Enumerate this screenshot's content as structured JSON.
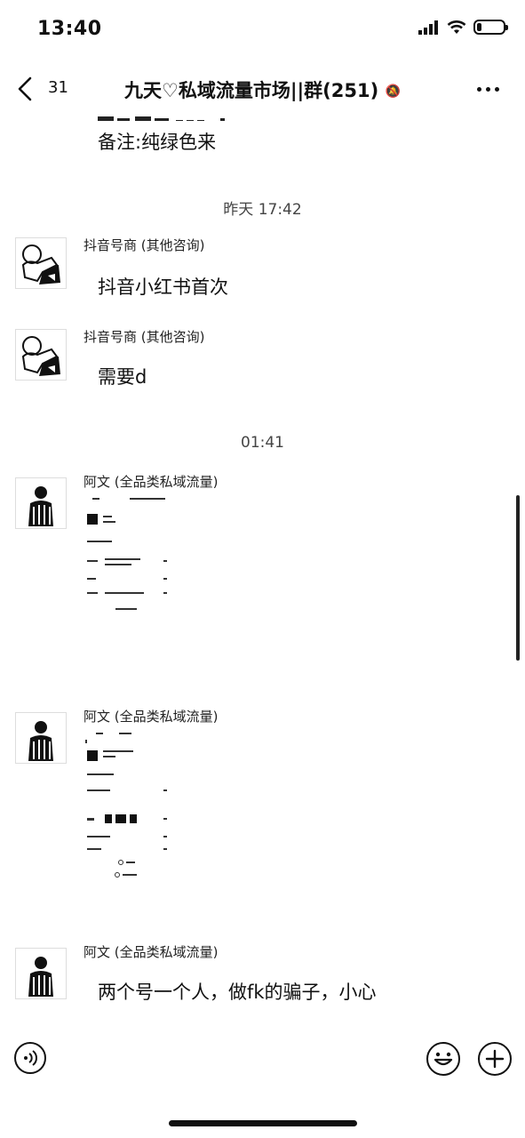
{
  "status_bar": {
    "time": "13:40"
  },
  "nav": {
    "back_count": "31",
    "title": "九天♡私域流量市场||群(251)",
    "mute_glyph": "🔕"
  },
  "partial_message": {
    "line1": "备注:纯绿色来"
  },
  "timestamps": {
    "t1": "昨天 17:42",
    "t2": "01:41"
  },
  "messages": [
    {
      "sender": "抖音号商 (其他咨询)",
      "text": "抖音小红书首次"
    },
    {
      "sender": "抖音号商 (其他咨询)",
      "text": "需要d"
    },
    {
      "sender": "阿文 (全品类私域流量)",
      "type": "image"
    },
    {
      "sender": "阿文 (全品类私域流量)",
      "type": "image"
    },
    {
      "sender": "阿文 (全品类私域流量)",
      "text": "两个号一个人，做fk的骗子，小心"
    }
  ]
}
